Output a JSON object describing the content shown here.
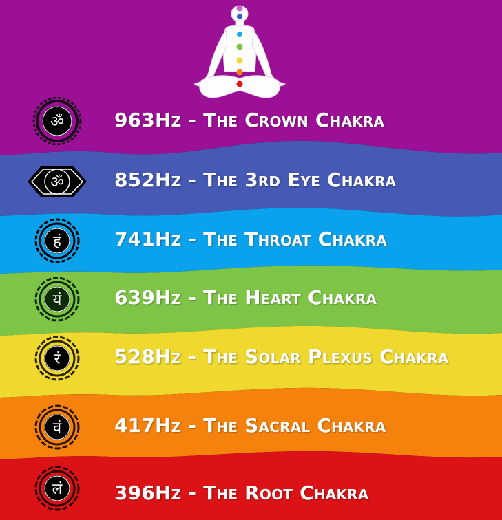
{
  "rows": [
    {
      "label": "963Hz - The Crown Chakra",
      "color": "#9b1094",
      "symbol": "ॐ"
    },
    {
      "label": "852Hz - The 3rd Eye Chakra",
      "color": "#4659b4",
      "symbol": "ॐ"
    },
    {
      "label": "741Hz - The Throat Chakra",
      "color": "#0aa2ec",
      "symbol": "हं"
    },
    {
      "label": "639Hz - The Heart Chakra",
      "color": "#7ec547",
      "symbol": "यं"
    },
    {
      "label": "528Hz - The Solar Plexus Chakra",
      "color": "#f0d92f",
      "symbol": "रं"
    },
    {
      "label": "417Hz - The Sacral Chakra",
      "color": "#f5820d",
      "symbol": "वं"
    },
    {
      "label": "396Hz - The Root Chakra",
      "color": "#dc1316",
      "symbol": "लं"
    }
  ],
  "icons": {
    "meditation_figure": "meditating-figure-icon",
    "emblems": [
      "crown-chakra-icon",
      "third-eye-chakra-icon",
      "throat-chakra-icon",
      "heart-chakra-icon",
      "solar-plexus-chakra-icon",
      "sacral-chakra-icon",
      "root-chakra-icon"
    ]
  }
}
